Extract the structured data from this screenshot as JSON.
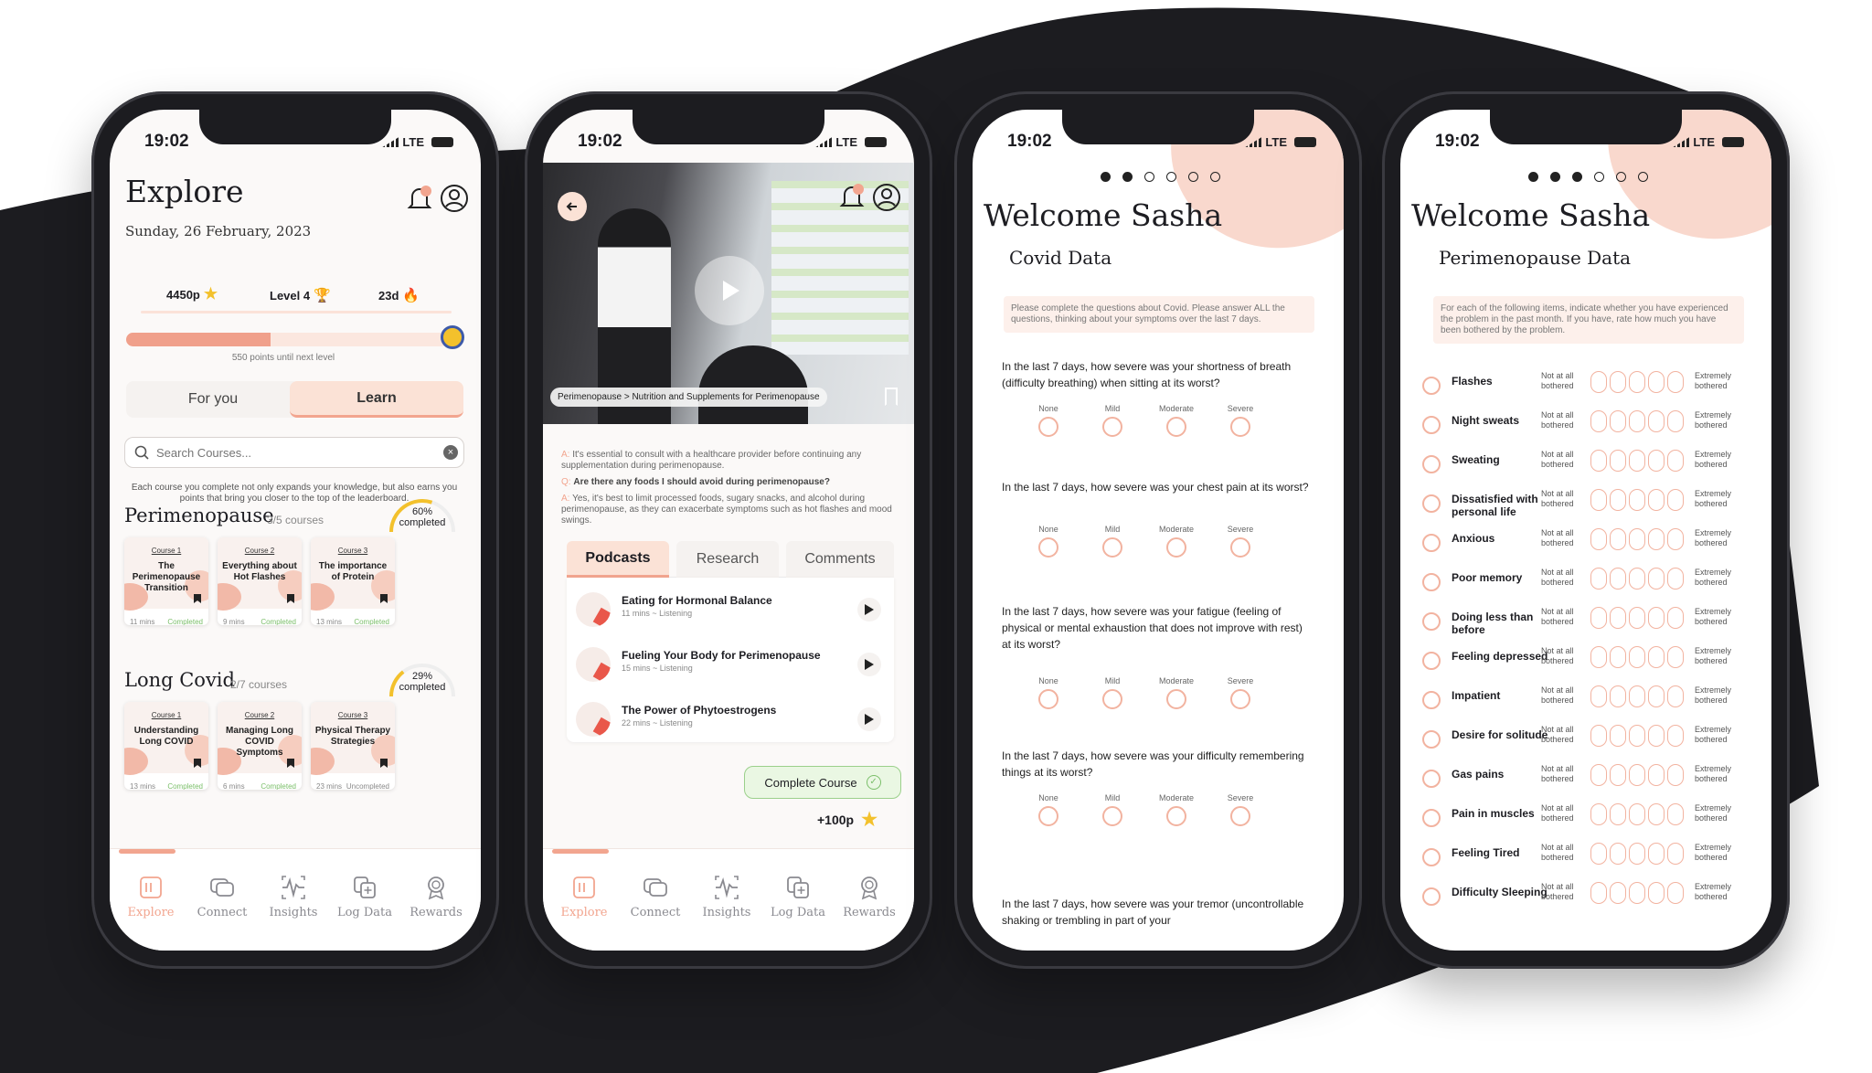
{
  "status": {
    "time": "19:02",
    "network": "LTE"
  },
  "explore": {
    "title": "Explore",
    "date": "Sunday, 26 February, 2023",
    "points": "4450p",
    "level": "Level 4",
    "streak": "23d",
    "progress": 0.45,
    "progress_caption": "550 points until next level",
    "tab_for_you": "For you",
    "tab_learn": "Learn",
    "search_placeholder": "Search Courses...",
    "intro": "Each course you complete not only expands your knowledge, but also earns you points that bring you closer to the top of the leaderboard.",
    "sections": [
      {
        "title": "Perimenopause",
        "count": "3/5 courses",
        "pct": "60%",
        "pct_label": "completed",
        "pct_value": 0.6,
        "courses": [
          {
            "num": "Course 1",
            "title": "The Perimenopause Transition",
            "mins": "11 mins",
            "status": "Completed"
          },
          {
            "num": "Course 2",
            "title": "Everything about Hot Flashes",
            "mins": "9 mins",
            "status": "Completed"
          },
          {
            "num": "Course 3",
            "title": "The importance of Protein",
            "mins": "13 mins",
            "status": "Completed"
          }
        ]
      },
      {
        "title": "Long Covid",
        "count": "2/7 courses",
        "pct": "29%",
        "pct_label": "completed",
        "pct_value": 0.29,
        "courses": [
          {
            "num": "Course 1",
            "title": "Understanding Long COVID",
            "mins": "13 mins",
            "status": "Completed"
          },
          {
            "num": "Course 2",
            "title": "Managing Long COVID Symptoms",
            "mins": "6 mins",
            "status": "Completed"
          },
          {
            "num": "Course 3",
            "title": "Physical Therapy Strategies",
            "mins": "23 mins",
            "status": "Uncompleted"
          }
        ]
      }
    ]
  },
  "nav": [
    "Explore",
    "Connect",
    "Insights",
    "Log Data",
    "Rewards"
  ],
  "course": {
    "breadcrumb": "Perimenopause > Nutrition and Supplements for Perimenopause",
    "qa": [
      {
        "prefix": "A:",
        "text": "It's essential to consult with a healthcare provider before continuing any supplementation during perimenopause."
      },
      {
        "prefix": "Q:",
        "text": "Are there any foods I should avoid during perimenopause?"
      },
      {
        "prefix": "A:",
        "text": "Yes, it's best to limit processed foods, sugary snacks, and alcohol during perimenopause, as they can exacerbate symptoms such as hot flashes and mood swings."
      }
    ],
    "tabs": [
      "Podcasts",
      "Research",
      "Comments"
    ],
    "podcasts": [
      {
        "title": "Eating for Hormonal Balance",
        "meta": "11 mins ~ Listening"
      },
      {
        "title": "Fueling Your Body for Perimenopause",
        "meta": "15 mins ~ Listening"
      },
      {
        "title": "The Power of Phytoestrogens",
        "meta": "22 mins ~ Listening"
      }
    ],
    "complete_label": "Complete Course",
    "reward": "+100p"
  },
  "covid": {
    "welcome": "Welcome Sasha",
    "subtitle": "Covid Data",
    "instructions": "Please complete the questions about Covid. Please answer ALL the questions, thinking about your symptoms over the last 7 days.",
    "options": [
      "None",
      "Mild",
      "Moderate",
      "Severe"
    ],
    "questions": [
      "In the last 7 days, how severe was your shortness of breath (difficulty breathing) when sitting at its worst?",
      "In the last 7 days, how severe was your chest pain at its worst?",
      "In the last 7 days, how severe was your fatigue (feeling of physical or mental exhaustion that does not improve with rest) at its worst?",
      "In the last 7 days, how severe was your difficulty remembering things at its worst?",
      "In the last 7 days, how severe was your tremor (uncontrollable shaking or trembling in part of your"
    ]
  },
  "peri": {
    "welcome": "Welcome Sasha",
    "subtitle": "Perimenopause Data",
    "instructions": "For each of the following items, indicate whether you have experienced the problem in the past month. If you have, rate how much you have been bothered by the problem.",
    "low": "Not at all bothered",
    "high": "Extremely bothered",
    "symptoms": [
      "Flashes",
      "Night sweats",
      "Sweating",
      "Dissatisfied with personal life",
      "Anxious",
      "Poor memory",
      "Doing less than before",
      "Feeling depressed",
      "Impatient",
      "Desire for solitude",
      "Gas pains",
      "Pain in muscles",
      "Feeling Tired",
      "Difficulty Sleeping"
    ]
  },
  "colors": {
    "accent": "#f2a58f",
    "accent_light": "#fbe7df",
    "green": "#7bbf6a",
    "dark_bg": "#1c1c20"
  }
}
